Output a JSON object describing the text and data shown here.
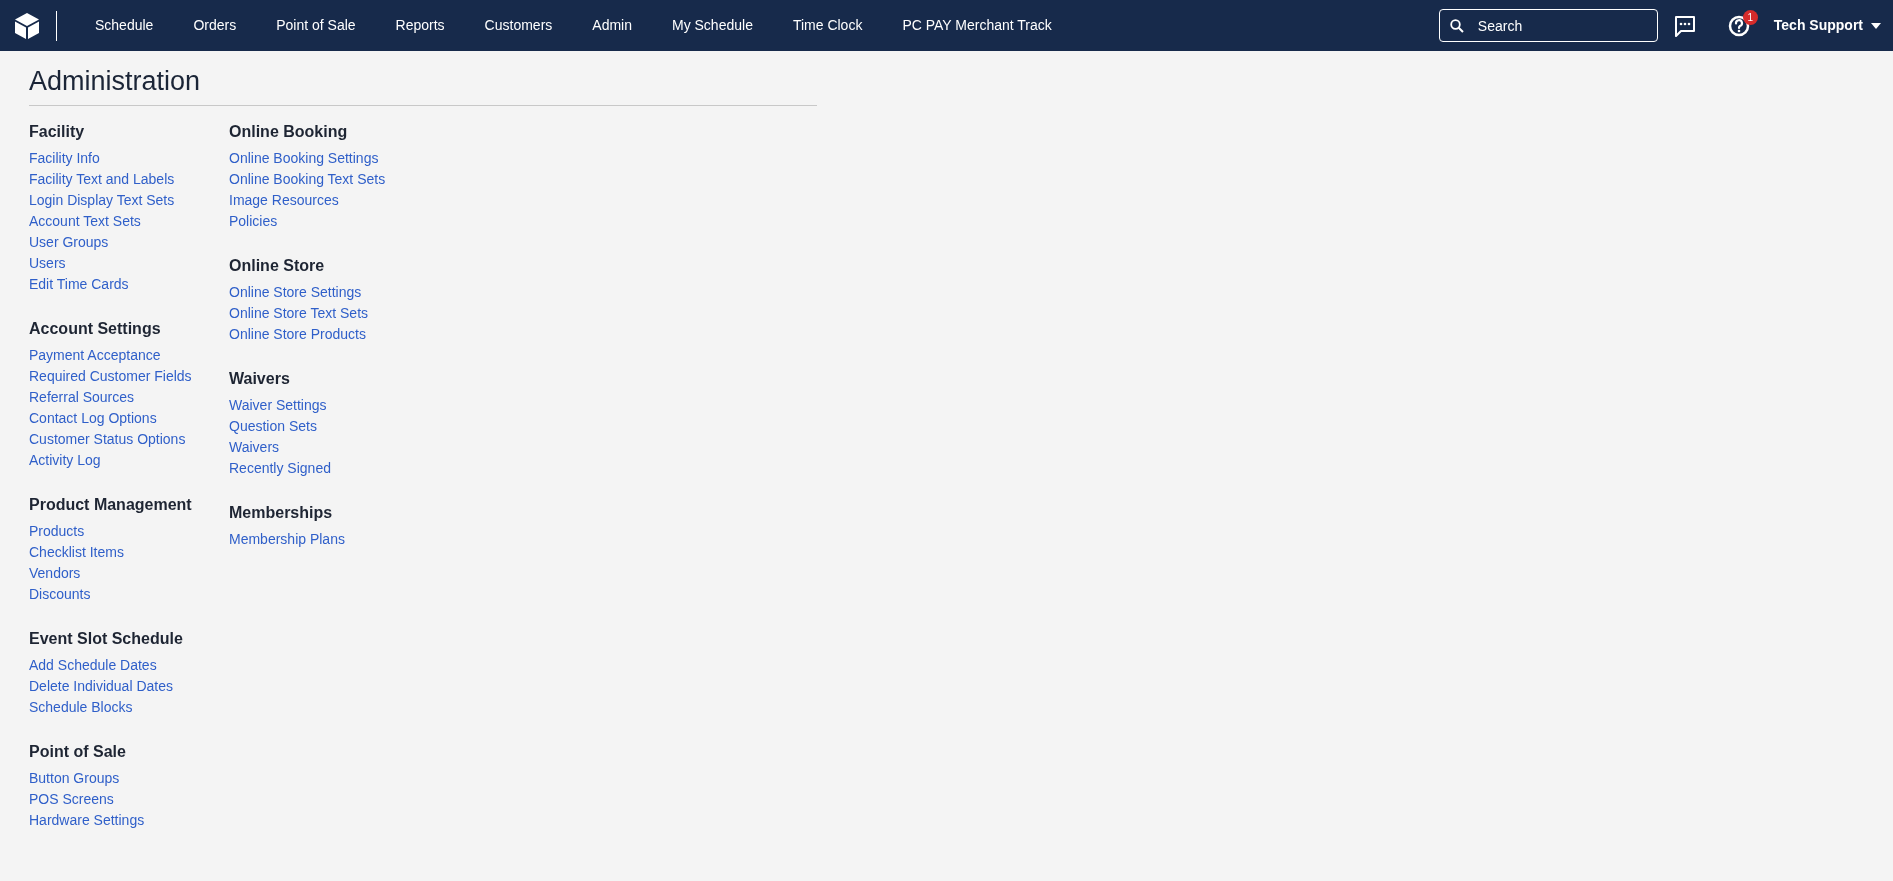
{
  "nav": {
    "items": [
      "Schedule",
      "Orders",
      "Point of Sale",
      "Reports",
      "Customers",
      "Admin",
      "My Schedule",
      "Time Clock",
      "PC PAY Merchant Track"
    ],
    "search": {
      "placeholder": "Search"
    },
    "help_badge": "1",
    "user": "Tech Support"
  },
  "page_title": "Administration",
  "columns": [
    [
      {
        "heading": "Facility",
        "links": [
          "Facility Info",
          "Facility Text and Labels",
          "Login Display Text Sets",
          "Account Text Sets",
          "User Groups",
          "Users",
          "Edit Time Cards"
        ]
      },
      {
        "heading": "Account Settings",
        "links": [
          "Payment Acceptance",
          "Required Customer Fields",
          "Referral Sources",
          "Contact Log Options",
          "Customer Status Options",
          "Activity Log"
        ]
      },
      {
        "heading": "Product Management",
        "links": [
          "Products",
          "Checklist Items",
          "Vendors",
          "Discounts"
        ]
      },
      {
        "heading": "Event Slot Schedule",
        "links": [
          "Add Schedule Dates",
          "Delete Individual Dates",
          "Schedule Blocks"
        ]
      },
      {
        "heading": "Point of Sale",
        "links": [
          "Button Groups",
          "POS Screens",
          "Hardware Settings"
        ]
      }
    ],
    [
      {
        "heading": "Online Booking",
        "links": [
          "Online Booking Settings",
          "Online Booking Text Sets",
          "Image Resources",
          "Policies"
        ]
      },
      {
        "heading": "Online Store",
        "links": [
          "Online Store Settings",
          "Online Store Text Sets",
          "Online Store Products"
        ]
      },
      {
        "heading": "Waivers",
        "links": [
          "Waiver Settings",
          "Question Sets",
          "Waivers",
          "Recently Signed"
        ]
      },
      {
        "heading": "Memberships",
        "links": [
          "Membership Plans"
        ]
      }
    ]
  ]
}
